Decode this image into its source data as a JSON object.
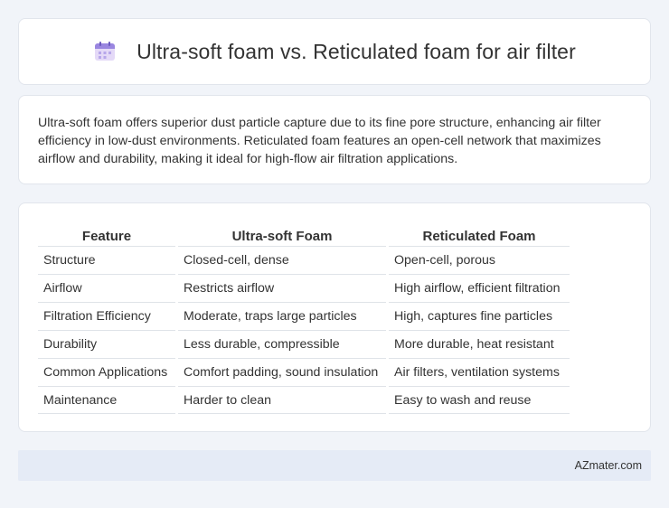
{
  "header": {
    "title": "Ultra-soft foam vs. Reticulated foam for air filter",
    "icon": "calendar-icon"
  },
  "intro": {
    "text": "Ultra-soft foam offers superior dust particle capture due to its fine pore structure, enhancing air filter efficiency in low-dust environments. Reticulated foam features an open-cell network that maximizes airflow and durability, making it ideal for high-flow air filtration applications."
  },
  "table": {
    "headers": [
      "Feature",
      "Ultra-soft Foam",
      "Reticulated Foam"
    ],
    "rows": [
      [
        "Structure",
        "Closed-cell, dense",
        "Open-cell, porous"
      ],
      [
        "Airflow",
        "Restricts airflow",
        "High airflow, efficient filtration"
      ],
      [
        "Filtration Efficiency",
        "Moderate, traps large particles",
        "High, captures fine particles"
      ],
      [
        "Durability",
        "Less durable, compressible",
        "More durable, heat resistant"
      ],
      [
        "Common Applications",
        "Comfort padding, sound insulation",
        "Air filters, ventilation systems"
      ],
      [
        "Maintenance",
        "Harder to clean",
        "Easy to wash and reuse"
      ]
    ]
  },
  "footer": {
    "text": "AZmater.com"
  }
}
